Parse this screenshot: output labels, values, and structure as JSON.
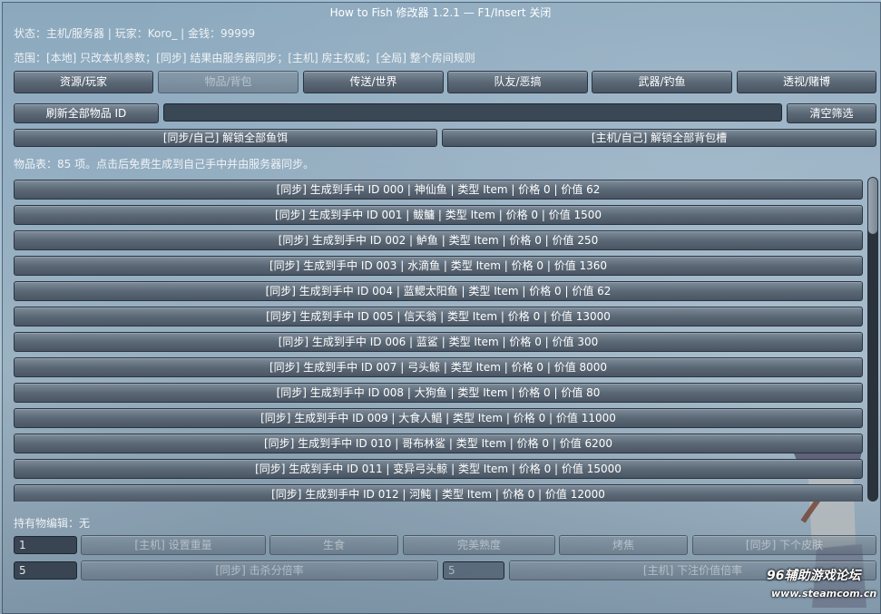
{
  "window": {
    "title": "How to Fish 修改器 1.2.1 — F1/Insert 关闭"
  },
  "status_line": "状态：主机/服务器 | 玩家：Koro_ | 金钱：99999",
  "scope_line": "范围：[本地] 只改本机参数；[同步] 结果由服务器同步；[主机] 房主权威；[全局] 整个房间规则",
  "tabs": [
    {
      "label": "资源/玩家"
    },
    {
      "label": "物品/背包"
    },
    {
      "label": "传送/世界"
    },
    {
      "label": "队友/恶搞"
    },
    {
      "label": "武器/钓鱼"
    },
    {
      "label": "透视/赌博"
    }
  ],
  "toolbar": {
    "refresh_label": "刷新全部物品 ID",
    "search_value": "",
    "clear_label": "清空筛选",
    "unlock_bait_label": "[同步/自己] 解锁全部鱼饵",
    "unlock_slots_label": "[主机/自己] 解锁全部背包槽"
  },
  "items_header": "物品表：85 项。点击后免费生成到自己手中并由服务器同步。",
  "items": [
    "[同步] 生成到手中  ID 000 | 神仙鱼 | 类型 Item | 价格 0 | 价值 62",
    "[同步] 生成到手中  ID 001 | 鲅鳙 | 类型 Item | 价格 0 | 价值 1500",
    "[同步] 生成到手中  ID 002 | 鲈鱼 | 类型 Item | 价格 0 | 价值 250",
    "[同步] 生成到手中  ID 003 | 水滴鱼 | 类型 Item | 价格 0 | 价值 1360",
    "[同步] 生成到手中  ID 004 | 蓝鳃太阳鱼 | 类型 Item | 价格 0 | 价值 62",
    "[同步] 生成到手中  ID 005 | 信天翁 | 类型 Item | 价格 0 | 价值 13000",
    "[同步] 生成到手中  ID 006 | 蓝鲨 | 类型 Item | 价格 0 | 价值 300",
    "[同步] 生成到手中  ID 007 | 弓头鲸 | 类型 Item | 价格 0 | 价值 8000",
    "[同步] 生成到手中  ID 008 | 大狗鱼 | 类型 Item | 价格 0 | 价值 80",
    "[同步] 生成到手中  ID 009 | 大食人鲳 | 类型 Item | 价格 0 | 价值 11000",
    "[同步] 生成到手中  ID 010 | 哥布林鲨 | 类型 Item | 价格 0 | 价值 6200",
    "[同步] 生成到手中  ID 011 | 变异弓头鲸 | 类型 Item | 价格 0 | 价值 15000",
    "[同步] 生成到手中  ID 012 | 河鲀 | 类型 Item | 价格 0 | 价值 12000"
  ],
  "held_editor": {
    "label": "持有物编辑：无",
    "weight_value": "1",
    "set_weight_label": "[主机] 设置重量",
    "raw_label": "生食",
    "perfect_label": "完美熟度",
    "burnt_label": "烤焦",
    "next_skin_label": "[同步] 下个皮肤",
    "kill_mult_value": "5",
    "kill_mult_label": "[同步] 击杀分倍率",
    "bet_mult_value": "5",
    "bet_mult_label": "[主机] 下注价值倍率"
  },
  "watermark": {
    "line1": "96辅助游戏论坛",
    "line2": "www.steamcom.cn"
  }
}
